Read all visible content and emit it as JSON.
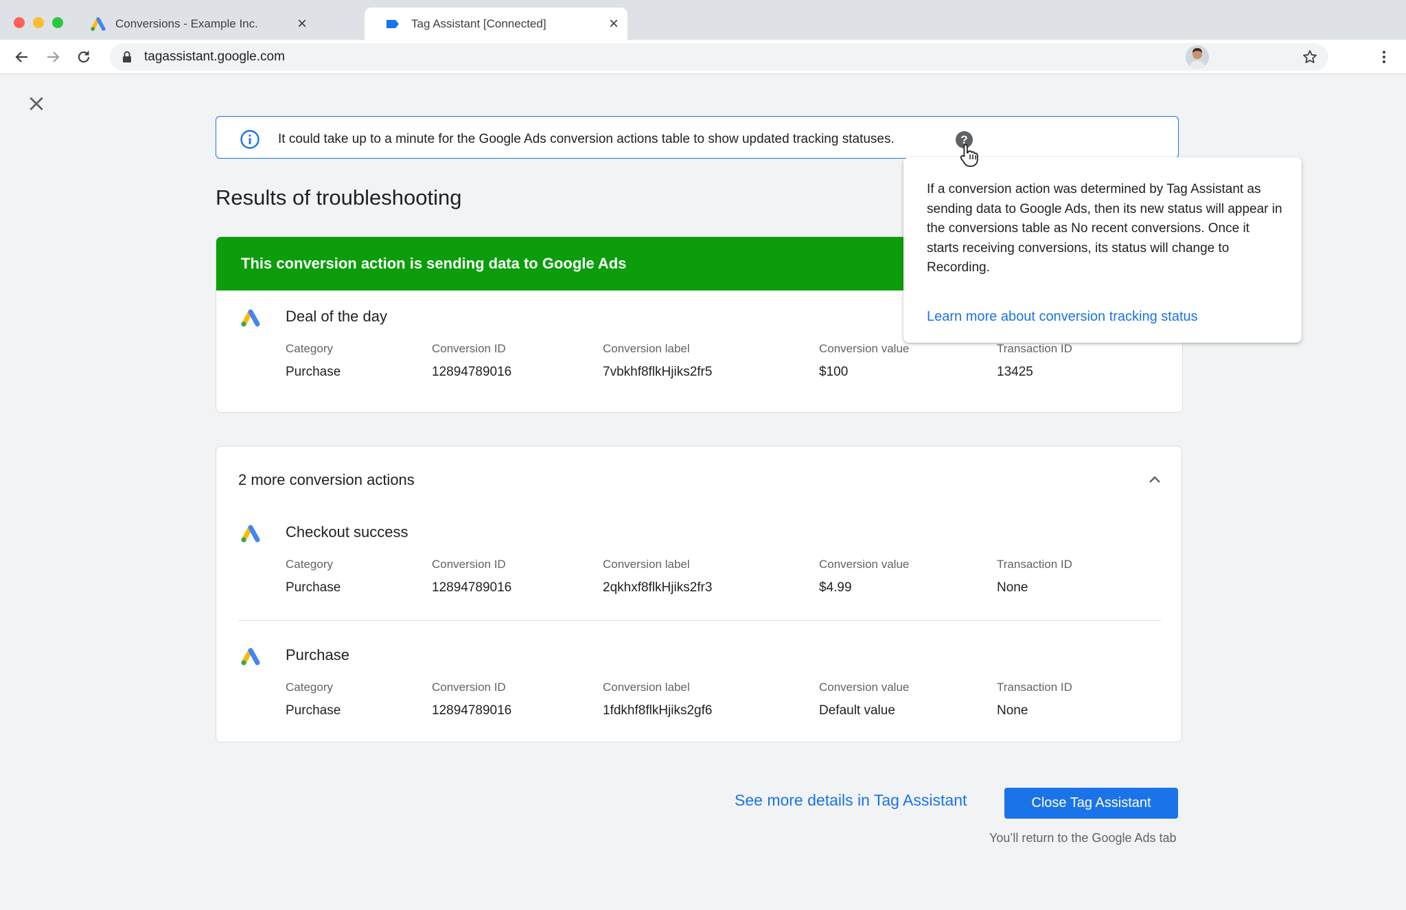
{
  "browser": {
    "tabs": [
      {
        "title": "Conversions - Example Inc.",
        "close": "×"
      },
      {
        "title": "Tag Assistant [Connected]",
        "close": "×"
      }
    ],
    "url": "tagassistant.google.com"
  },
  "banner": {
    "text": "It could take up to a minute for the Google Ads conversion actions table to show updated tracking statuses.",
    "help": "?"
  },
  "page": {
    "title": "Results of troubleshooting"
  },
  "sending_card": {
    "header": "This conversion action is sending data to Google Ads",
    "action": {
      "name": "Deal of the day",
      "fields": [
        {
          "label": "Category",
          "value": "Purchase"
        },
        {
          "label": "Conversion ID",
          "value": "12894789016"
        },
        {
          "label": "Conversion label",
          "value": "7vbkhf8flkHjiks2fr5"
        },
        {
          "label": "Conversion value",
          "value": "$100"
        },
        {
          "label": "Transaction ID",
          "value": "13425"
        }
      ]
    }
  },
  "more_card": {
    "title": "2 more conversion actions",
    "actions": [
      {
        "name": "Checkout success",
        "fields": [
          {
            "label": "Category",
            "value": "Purchase"
          },
          {
            "label": "Conversion ID",
            "value": "12894789016"
          },
          {
            "label": "Conversion label",
            "value": "2qkhxf8flkHjiks2fr3"
          },
          {
            "label": "Conversion value",
            "value": "$4.99"
          },
          {
            "label": "Transaction ID",
            "value": "None"
          }
        ]
      },
      {
        "name": "Purchase",
        "fields": [
          {
            "label": "Category",
            "value": "Purchase"
          },
          {
            "label": "Conversion ID",
            "value": "12894789016"
          },
          {
            "label": "Conversion label",
            "value": "1fdkhf8flkHjiks2gf6"
          },
          {
            "label": "Conversion value",
            "value": "Default value"
          },
          {
            "label": "Transaction ID",
            "value": "None"
          }
        ]
      }
    ]
  },
  "tooltip": {
    "text": "If a conversion action was determined by Tag Assistant as sending data to Google Ads, then its new status will appear in the conversions table as No recent conversions. Once it starts receiving conversions, its status will change to Recording.",
    "link": "Learn more about conversion tracking status"
  },
  "footer": {
    "details_link": "See more details in Tag Assistant",
    "close_button": "Close Tag Assistant",
    "return_note": "You’ll return to the Google Ads tab"
  },
  "colors": {
    "primary": "#1a73e8",
    "success_green": "#0b9d0b"
  }
}
